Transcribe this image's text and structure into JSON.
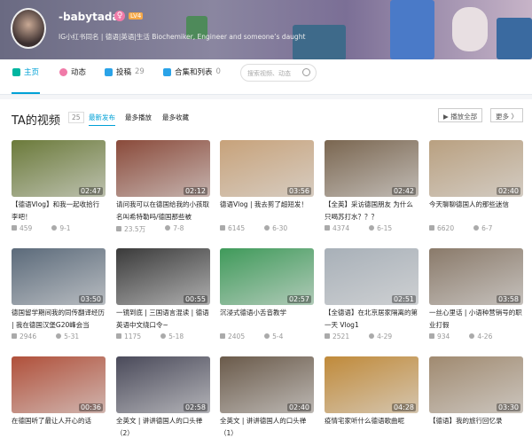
{
  "profile": {
    "name": "-babytada",
    "gender": "♀",
    "level": "LV4",
    "sign": "IG小红书同名 | 德语|英语|生活 Biochemiker, Engineer and someone’s daught"
  },
  "nav": {
    "items": [
      {
        "label": "主页"
      },
      {
        "label": "动态"
      },
      {
        "label": "投稿",
        "count": "29"
      },
      {
        "label": "合集和列表",
        "count": "0"
      }
    ],
    "search_placeholder": "搜索视频、动态"
  },
  "section": {
    "title": "TA的视频",
    "count": "25",
    "tabs": [
      "最新发布",
      "最多播放",
      "最多收藏"
    ],
    "play_all": "播放全部",
    "more": "更多 〉"
  },
  "videos": [
    {
      "title": "【德语Vlog】和我一起收拾行李吧！",
      "views": "459",
      "date": "9-1",
      "duration": "02:47",
      "color": "#6b7a3a"
    },
    {
      "title": "请问我可以在德国给我的小孩取名叫希特勒吗/德国那些被",
      "views": "23.5万",
      "date": "7-8",
      "duration": "02:12",
      "color": "#8a4a3a"
    },
    {
      "title": "德语Vlog | 我去剪了超短发！",
      "views": "6145",
      "date": "6-30",
      "duration": "03:56",
      "color": "#c7a27a"
    },
    {
      "title": "【全英】采访德国朋友 为什么只喝苏打水？？？",
      "views": "4374",
      "date": "6-15",
      "duration": "02:42",
      "color": "#7a6650"
    },
    {
      "title": "今天聊聊德国人的那些迷信",
      "views": "6620",
      "date": "6-7",
      "duration": "02:40",
      "color": "#b9a080"
    },
    {
      "title": "德国留学期间我的同传翻译经历 | 我在德国汉堡G20峰会当",
      "views": "2946",
      "date": "5-31",
      "duration": "03:50",
      "color": "#5b6a7a"
    },
    {
      "title": "一镜到底 | 三国语言混读 | 德语英语中文绕口令~",
      "views": "1175",
      "date": "5-18",
      "duration": "00:55",
      "color": "#3a3a3a"
    },
    {
      "title": "沉浸式德语小舌音教学",
      "views": "2405",
      "date": "5-4",
      "duration": "02:57",
      "color": "#3f9a5a"
    },
    {
      "title": "【全德语】在北京居家隔离的第一天 Vlog1",
      "views": "2521",
      "date": "4-29",
      "duration": "02:51",
      "color": "#a8b0b8"
    },
    {
      "title": "一丝心里话 | 小语种营销号的职业打假",
      "views": "934",
      "date": "4-26",
      "duration": "03:58",
      "color": "#8a7a6a"
    },
    {
      "title": "在德国听了最让人开心的话",
      "views": "",
      "date": "",
      "duration": "00:36",
      "color": "#b0503a"
    },
    {
      "title": "全英文 | 讲讲德国人的口头禅（2）",
      "views": "",
      "date": "",
      "duration": "02:58",
      "color": "#4a4a5a"
    },
    {
      "title": "全英文 | 讲讲德国人的口头禅（1）",
      "views": "",
      "date": "",
      "duration": "02:40",
      "color": "#6a5a4a"
    },
    {
      "title": "疫情宅家听什么德语歌曲呢",
      "views": "",
      "date": "",
      "duration": "04:28",
      "color": "#c08a3a"
    },
    {
      "title": "【德语】我的旅行回忆录",
      "views": "",
      "date": "",
      "duration": "03:30",
      "color": "#a08a70"
    }
  ]
}
